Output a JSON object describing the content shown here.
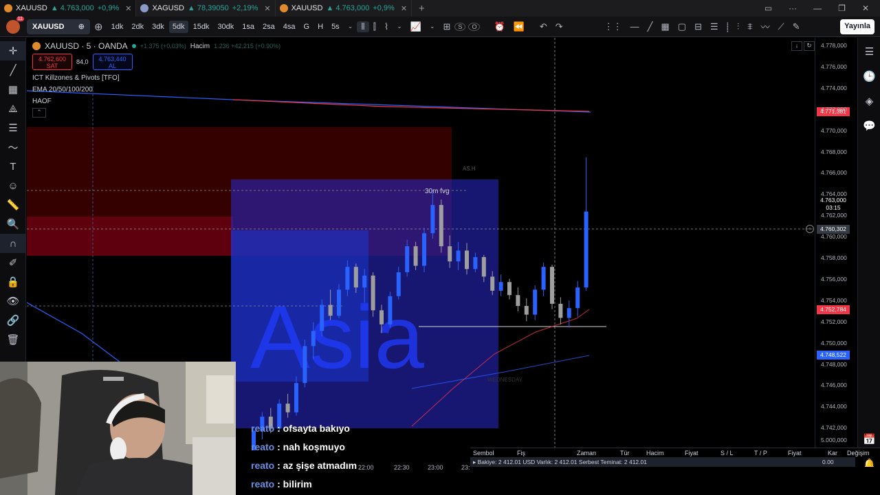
{
  "browser_tabs": [
    {
      "symbol": "XAUUSD",
      "price": "▲ 4.763,000",
      "change": "+0,9%",
      "active": true
    },
    {
      "symbol": "XAGUSD",
      "price": "▲ 78,39050",
      "change": "+2,19%",
      "active": false
    },
    {
      "symbol": "XAUUSD",
      "price": "▲ 4.763,000",
      "change": "+0,9%",
      "active": false
    }
  ],
  "toolbar": {
    "avatar_badge": "11",
    "symbol": "XAUUSD",
    "timeframes": [
      "1dk",
      "2dk",
      "3dk",
      "5dk",
      "15dk",
      "30dk",
      "1sa",
      "2sa",
      "4sa",
      "G",
      "H",
      "5s"
    ],
    "selected_timeframe": "5dk",
    "publish_label": "Yayınla",
    "s_label": "S",
    "o_label": "O"
  },
  "legend": {
    "title": "XAUUSD · 5 · OANDA",
    "change_dim": "+1.375 (+0.03%)",
    "volume_label": "Hacim",
    "volume_dim": "1.236  +42.215 (+0.90%)",
    "sell_price": "4.762,600",
    "sell_label": "SAT",
    "spread": "84,0",
    "buy_price": "4.763,440",
    "buy_label": "AL",
    "indicators": [
      "ICT Killzones & Pivots [TFO]",
      "EMA 20/50/100/200",
      "HAOF"
    ]
  },
  "chart_annotations": {
    "fvg_label": "30m fvg",
    "session_label": "Asia",
    "ash_label": "AS.H",
    "day_label": "WEDNESDAY"
  },
  "price_axis": {
    "ticks": [
      "4.778,000",
      "4.776,000",
      "4.774,000",
      "4.772,000",
      "4.770,000",
      "4.768,000",
      "4.766,000",
      "4.764,000",
      "4.762,000",
      "4.760,000",
      "4.758,000",
      "4.756,000",
      "4.754,000",
      "4.752,000",
      "4.750,000",
      "4.748,000",
      "4.746,000",
      "4.744,000",
      "4.742,000"
    ],
    "ema_red_badge": "4.771,381",
    "current_price": "4.763,000",
    "countdown": "03:15",
    "crosshair_price": "4.760,302",
    "ema_red2_badge": "4.752,784",
    "ema_blue_badge": "4.748,522",
    "volume_tick": "5.000,000"
  },
  "time_axis": [
    "22:00",
    "22:30",
    "23:00",
    "23:"
  ],
  "bottom_panel": {
    "headers": [
      "Sembol",
      "Fiş",
      "Zaman",
      "Tür",
      "Hacim",
      "Fiyat",
      "S / L",
      "T / P",
      "Fiyat",
      "Kar",
      "Değişim"
    ],
    "balance_text": "Bakiye: 2 412.01 USD   Varlık: 2 412.01   Serbest Teminat: 2 412.01",
    "balance_value": "0.00"
  },
  "chat": [
    {
      "user": "reato",
      "message": ": ofsayta bakıyo"
    },
    {
      "user": "reato",
      "message": ": nah koşmuyo"
    },
    {
      "user": "reato",
      "message": ": az şişe atmadım"
    },
    {
      "user": "reato",
      "message": ": bilirim"
    }
  ],
  "colors": {
    "bull": "#2962ff",
    "bear": "#9e9e9e",
    "ema_red": "#f23645",
    "ema_blue": "#2962ff",
    "fvg_box": "#2a2ad0",
    "red_zone": "#4a0000"
  },
  "chart_data": {
    "type": "candlestick",
    "interval": "5m",
    "ylim": [
      4741,
      4779
    ],
    "candles": [
      [
        4741.0,
        4743.2,
        4740.6,
        4742.8
      ],
      [
        4742.8,
        4744.5,
        4742.0,
        4744.1
      ],
      [
        4744.1,
        4744.9,
        4742.6,
        4743.0
      ],
      [
        4743.0,
        4745.7,
        4742.8,
        4745.3
      ],
      [
        4745.3,
        4746.2,
        4744.0,
        4744.5
      ],
      [
        4744.5,
        4747.8,
        4744.2,
        4747.2
      ],
      [
        4747.2,
        4751.2,
        4746.8,
        4750.6
      ],
      [
        4750.6,
        4752.8,
        4749.4,
        4752.0
      ],
      [
        4752.0,
        4754.9,
        4751.5,
        4754.4
      ],
      [
        4754.4,
        4755.8,
        4753.0,
        4753.4
      ],
      [
        4753.4,
        4756.3,
        4753.2,
        4755.8
      ],
      [
        4755.8,
        4758.5,
        4755.2,
        4757.9
      ],
      [
        4757.9,
        4758.2,
        4755.5,
        4756.0
      ],
      [
        4756.0,
        4757.7,
        4754.6,
        4757.1
      ],
      [
        4757.1,
        4757.4,
        4753.3,
        4753.9
      ],
      [
        4753.9,
        4754.4,
        4751.8,
        4752.6
      ],
      [
        4752.6,
        4755.6,
        4752.3,
        4755.2
      ],
      [
        4755.2,
        4757.9,
        4754.9,
        4757.4
      ],
      [
        4757.4,
        4760.4,
        4757.0,
        4759.8
      ],
      [
        4759.8,
        4760.2,
        4757.6,
        4758.0
      ],
      [
        4758.0,
        4761.5,
        4757.4,
        4761.0
      ],
      [
        4761.0,
        4764.9,
        4760.5,
        4763.6
      ],
      [
        4763.6,
        4764.1,
        4759.2,
        4759.8
      ],
      [
        4759.8,
        4760.8,
        4757.8,
        4758.4
      ],
      [
        4758.4,
        4760.2,
        4757.6,
        4759.4
      ],
      [
        4759.4,
        4760.1,
        4757.2,
        4757.7
      ],
      [
        4757.7,
        4759.2,
        4757.4,
        4758.8
      ],
      [
        4758.8,
        4759.0,
        4756.5,
        4757.0
      ],
      [
        4757.0,
        4757.5,
        4755.3,
        4755.7
      ],
      [
        4755.7,
        4757.2,
        4755.2,
        4756.5
      ],
      [
        4756.5,
        4756.8,
        4754.9,
        4755.3
      ],
      [
        4755.3,
        4756.0,
        4753.8,
        4754.3
      ],
      [
        4754.3,
        4755.0,
        4752.9,
        4753.5
      ],
      [
        4753.5,
        4756.2,
        4753.0,
        4755.8
      ],
      [
        4755.8,
        4758.3,
        4755.2,
        4757.9
      ],
      [
        4757.9,
        4758.1,
        4754.0,
        4754.5
      ],
      [
        4754.5,
        4755.1,
        4752.6,
        4753.2
      ],
      [
        4753.2,
        4754.8,
        4752.3,
        4754.1
      ],
      [
        4754.1,
        4756.6,
        4753.3,
        4756.0
      ],
      [
        4756.0,
        4768.0,
        4755.7,
        4763.0
      ]
    ]
  }
}
